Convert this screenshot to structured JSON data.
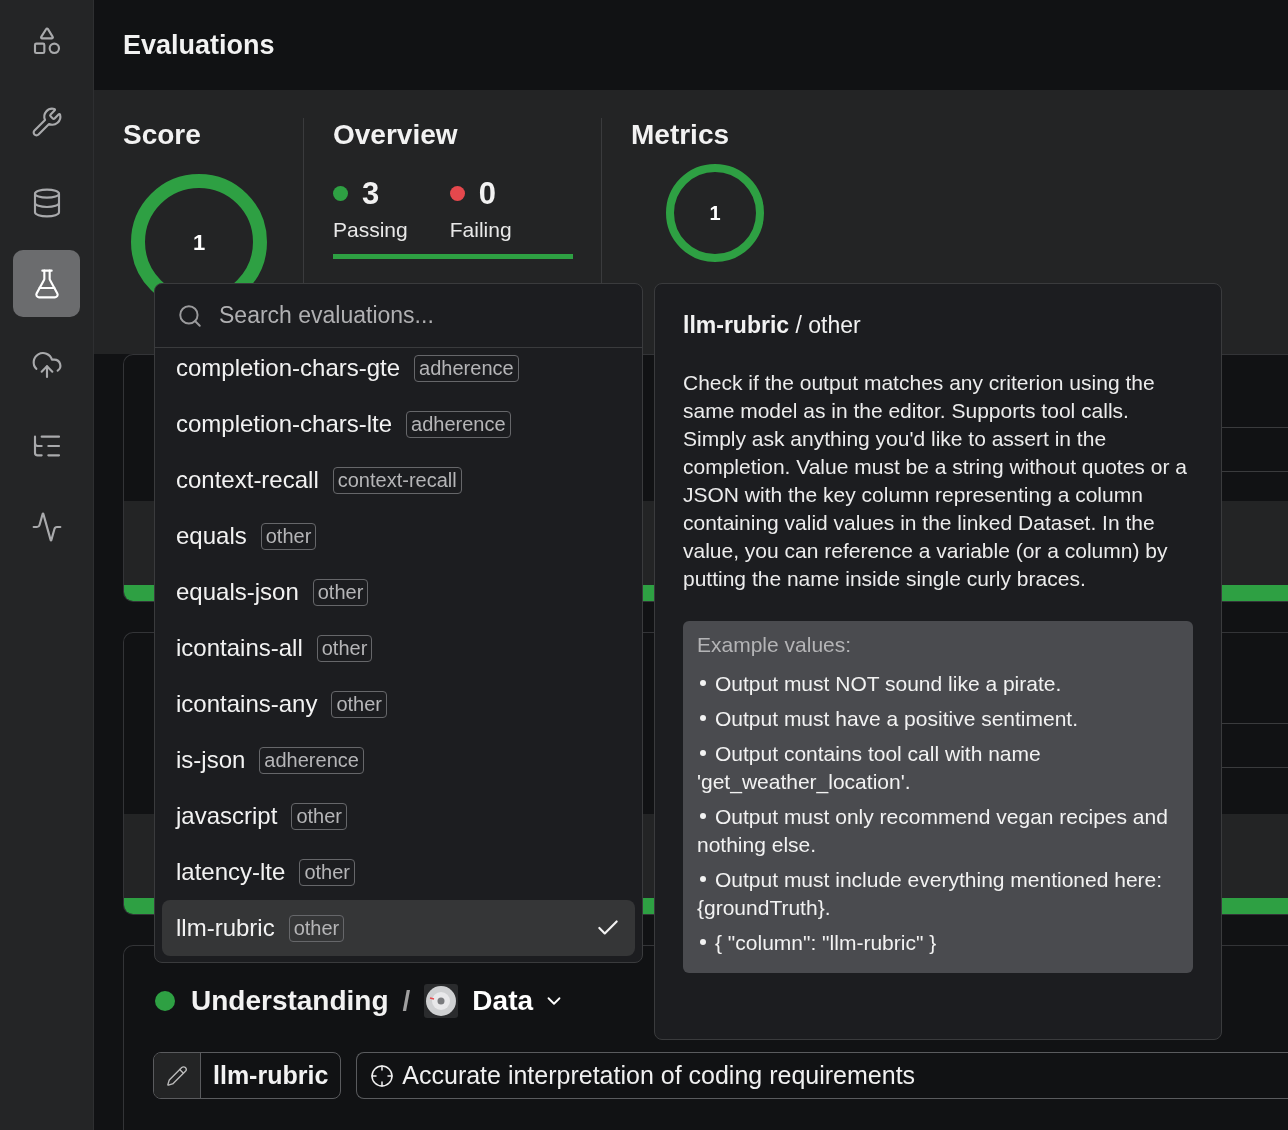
{
  "sidebar": {
    "items": [
      {
        "selected": false
      },
      {
        "selected": false
      },
      {
        "selected": false
      },
      {
        "selected": true
      },
      {
        "selected": false
      },
      {
        "selected": false
      },
      {
        "selected": false
      }
    ]
  },
  "header": {
    "title": "Evaluations"
  },
  "score": {
    "title": "Score",
    "value": "1"
  },
  "overview": {
    "title": "Overview",
    "level": 1,
    "stats": [
      {
        "count": "3",
        "label": "Passing",
        "color": "#2ea043"
      },
      {
        "count": "0",
        "label": "Failing",
        "color": "#e5484d"
      }
    ]
  },
  "metrics": {
    "title": "Metrics",
    "value": "1"
  },
  "search": {
    "placeholder": "Search evaluations..."
  },
  "evaluations": [
    {
      "name": "completion-chars-gte",
      "tag": "adherence",
      "selected": false
    },
    {
      "name": "completion-chars-lte",
      "tag": "adherence",
      "selected": false
    },
    {
      "name": "context-recall",
      "tag": "context-recall",
      "selected": false
    },
    {
      "name": "equals",
      "tag": "other",
      "selected": false
    },
    {
      "name": "equals-json",
      "tag": "other",
      "selected": false
    },
    {
      "name": "icontains-all",
      "tag": "other",
      "selected": false
    },
    {
      "name": "icontains-any",
      "tag": "other",
      "selected": false
    },
    {
      "name": "is-json",
      "tag": "adherence",
      "selected": false
    },
    {
      "name": "javascript",
      "tag": "other",
      "selected": false
    },
    {
      "name": "latency-lte",
      "tag": "other",
      "selected": false
    },
    {
      "name": "llm-rubric",
      "tag": "other",
      "selected": true
    }
  ],
  "detail": {
    "title": "**llm-rubric** / other",
    "description": "Check if the output matches any criterion using the same model as in the editor. Supports tool calls. Simply ask anything you'd like to assert in the completion. Value must be a string without quotes or a JSON with the key column representing a column containing valid values in the linked Dataset. In the value, you can reference a variable (or a column) by putting the name inside single curly braces.",
    "examples_label": "Example values:",
    "examples": [
      "Output must NOT sound like a pirate.",
      "Output must have a positive sentiment.",
      "Output contains tool call with name 'get_weather_location'.",
      "Output must only recommend vegan recipes and nothing else.",
      "Output must include everything mentioned here: {groundTruth}.",
      "{ \"column\": \"llm-rubric\" }"
    ]
  },
  "group": {
    "passing": true,
    "title": "Understanding",
    "separator": "/",
    "dataset": "Data",
    "evaluator": "llm-rubric",
    "criterion": "Accurate interpretation of coding requirements"
  }
}
